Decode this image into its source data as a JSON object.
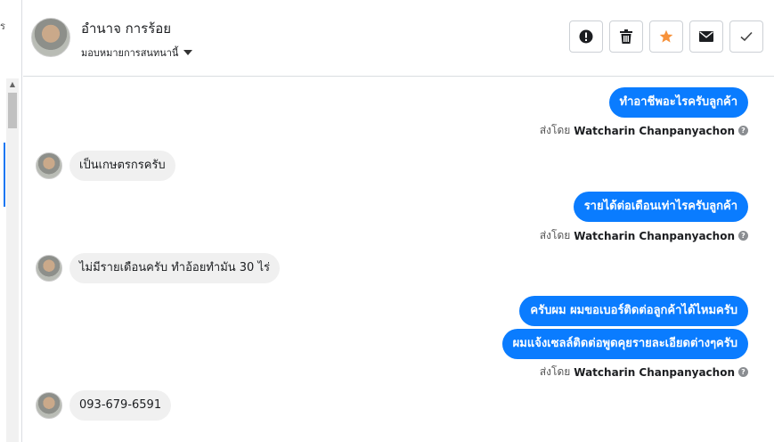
{
  "left_strip": {
    "fragment": "ร"
  },
  "header": {
    "contact_name": "อำนาจ การร้อย",
    "assign_label": "มอบหมายการสนทนานี้",
    "actions": [
      {
        "name": "report",
        "icon": "exclamation-circle-icon"
      },
      {
        "name": "delete",
        "icon": "trash-icon"
      },
      {
        "name": "star",
        "icon": "star-icon",
        "color": "#f7923b"
      },
      {
        "name": "mark-unread",
        "icon": "envelope-icon"
      },
      {
        "name": "done",
        "icon": "check-icon"
      }
    ]
  },
  "messages": [
    {
      "dir": "out",
      "text": "ทำอาชีพอะไรครับลูกค้า"
    },
    {
      "dir": "sentby",
      "prefix": "ส่งโดย",
      "name": "Watcharin Chanpanyachon"
    },
    {
      "dir": "in",
      "text": "เป็นเกษตรกรครับ"
    },
    {
      "dir": "out",
      "text": "รายได้ต่อเดือนเท่าไรครับลูกค้า"
    },
    {
      "dir": "sentby",
      "prefix": "ส่งโดย",
      "name": "Watcharin Chanpanyachon"
    },
    {
      "dir": "in",
      "text": "ไม่มีรายเดือนครับ ทำอ้อยทำมัน 30 ไร่"
    },
    {
      "dir": "out",
      "text": "ครับผม ผมขอเบอร์ติดต่อลูกค้าได้ไหมครับ"
    },
    {
      "dir": "out",
      "text": "ผมแจ้งเซลล์ติดต่อพูดคุยรายละเอียดต่างๆครับ"
    },
    {
      "dir": "sentby",
      "prefix": "ส่งโดย",
      "name": "Watcharin Chanpanyachon"
    },
    {
      "dir": "in",
      "text": "093-679-6591"
    }
  ],
  "colors": {
    "outgoing_bubble": "#0a7cff",
    "incoming_bubble": "#f0f0f0",
    "accent": "#1877f2"
  }
}
